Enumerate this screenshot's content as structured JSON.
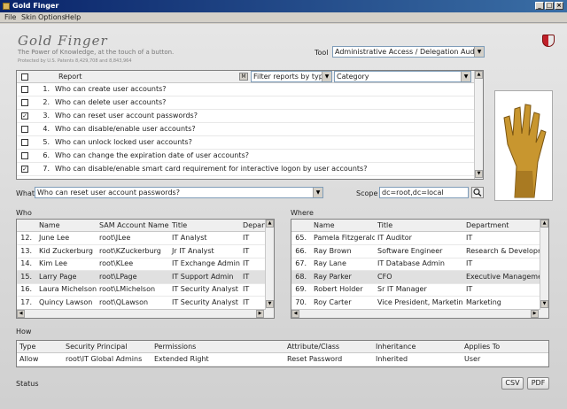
{
  "window": {
    "title": "Gold Finger"
  },
  "menu": [
    "File",
    "Skin",
    "Options",
    "Help"
  ],
  "brand": {
    "title": "Gold Finger",
    "slogan": "The Power of Knowledge, at the touch of a button.",
    "patent": "Protected by U.S. Patents 8,429,708 and 8,843,964"
  },
  "tool": {
    "label": "Tool",
    "value": "Administrative Access / Delegation Audit Tool"
  },
  "reports": {
    "header": "Report",
    "m_button": "M",
    "filter_value": "Filter reports by type",
    "category_value": "Category",
    "items": [
      {
        "num": "1.",
        "text": "Who can create user accounts?",
        "checked": false
      },
      {
        "num": "2.",
        "text": "Who can delete user accounts?",
        "checked": false
      },
      {
        "num": "3.",
        "text": "Who can reset user account passwords?",
        "checked": true
      },
      {
        "num": "4.",
        "text": "Who can disable/enable user accounts?",
        "checked": false
      },
      {
        "num": "5.",
        "text": "Who can unlock locked user accounts?",
        "checked": false
      },
      {
        "num": "6.",
        "text": "Who can change the expiration date of user accounts?",
        "checked": false
      },
      {
        "num": "7.",
        "text": "Who can disable/enable smart card requirement for interactive logon by user accounts?",
        "checked": true
      }
    ]
  },
  "what": {
    "label": "What",
    "value": "Who can reset user account passwords?"
  },
  "scope": {
    "label": "Scope",
    "value": "dc=root,dc=local"
  },
  "who": {
    "label": "Who",
    "columns": [
      "Name",
      "SAM Account Name",
      "Title",
      "Departm"
    ],
    "rows": [
      {
        "num": "12.",
        "name": "June Lee",
        "sam": "root\\JLee",
        "title": "IT Analyst",
        "dept": "IT"
      },
      {
        "num": "13.",
        "name": "Kid Zuckerburg",
        "sam": "root\\KZuckerburg",
        "title": "Jr IT Analyst",
        "dept": "IT"
      },
      {
        "num": "14.",
        "name": "Kim Lee",
        "sam": "root\\KLee",
        "title": "IT Exchange Admin",
        "dept": "IT"
      },
      {
        "num": "15.",
        "name": "Larry Page",
        "sam": "root\\LPage",
        "title": "IT Support Admin",
        "dept": "IT"
      },
      {
        "num": "16.",
        "name": "Laura Michelson",
        "sam": "root\\LMichelson",
        "title": "IT Security Analyst",
        "dept": "IT"
      },
      {
        "num": "17.",
        "name": "Quincy Lawson",
        "sam": "root\\QLawson",
        "title": "IT Security Analyst",
        "dept": "IT"
      }
    ]
  },
  "where": {
    "label": "Where",
    "columns": [
      "Name",
      "Title",
      "Department"
    ],
    "rows": [
      {
        "num": "65.",
        "name": "Pamela Fitzgerald",
        "title": "IT Auditor",
        "dept": "IT"
      },
      {
        "num": "66.",
        "name": "Ray Brown",
        "title": "Software Engineer",
        "dept": "Research & Developme"
      },
      {
        "num": "67.",
        "name": "Ray Lane",
        "title": "IT Database Admin",
        "dept": "IT"
      },
      {
        "num": "68.",
        "name": "Ray Parker",
        "title": "CFO",
        "dept": "Executive Managemen"
      },
      {
        "num": "69.",
        "name": "Robert Holder",
        "title": "Sr IT Manager",
        "dept": "IT"
      },
      {
        "num": "70.",
        "name": "Roy Carter",
        "title": "Vice President, Marketing",
        "dept": "Marketing"
      }
    ]
  },
  "how": {
    "label": "How",
    "columns": [
      "Type",
      "Security Principal",
      "Permissions",
      "Attribute/Class",
      "Inheritance",
      "Applies To"
    ],
    "row": [
      "Allow",
      "root\\IT Global Admins",
      "Extended Right",
      "Reset Password",
      "Inherited",
      "User"
    ]
  },
  "status": {
    "label": "Status"
  },
  "buttons": {
    "csv": "CSV",
    "pdf": "PDF"
  }
}
